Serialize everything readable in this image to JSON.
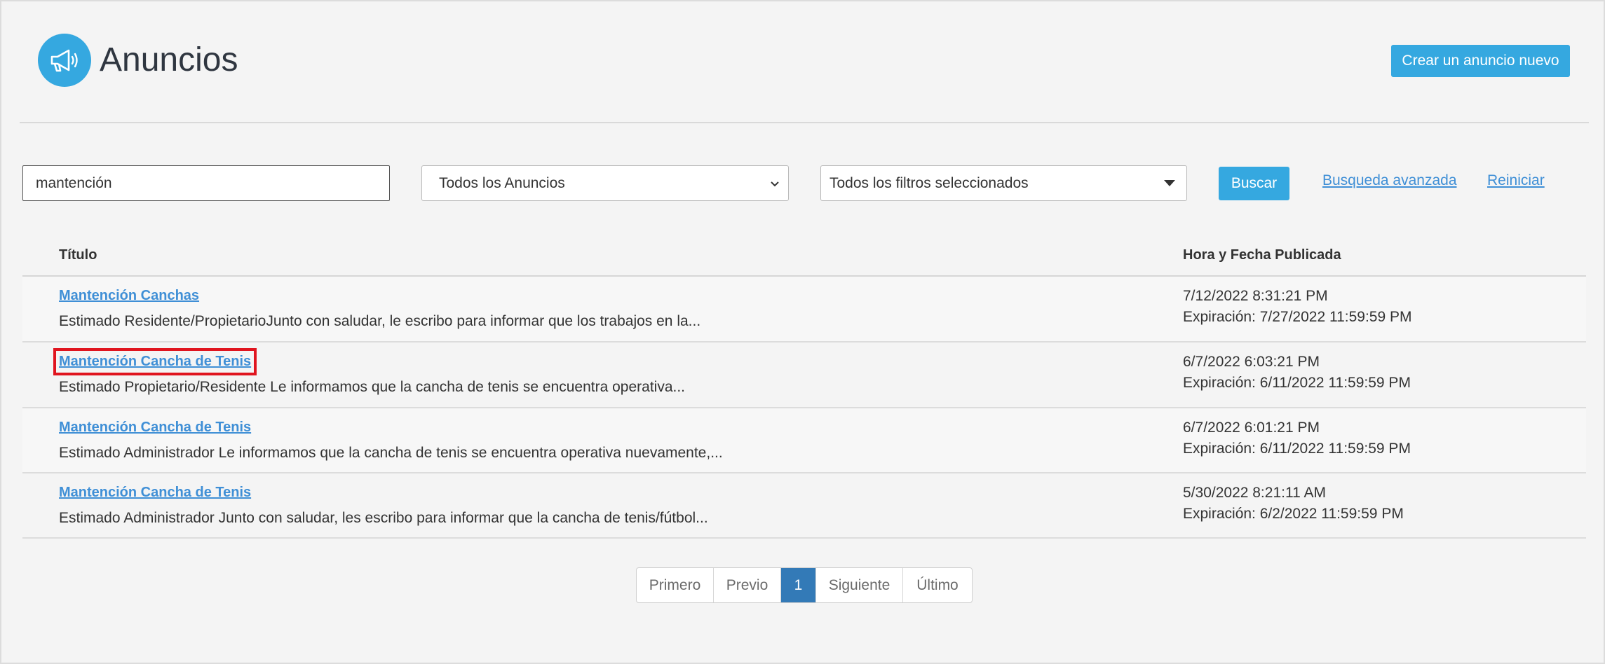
{
  "header": {
    "title": "Anuncios",
    "logo_icon": "megaphone-icon",
    "create_button": "Crear un anuncio nuevo"
  },
  "filters": {
    "search_value": "mantención",
    "type_select": "Todos los Anuncios",
    "filter_select": "Todos los filtros seleccionados",
    "search_button": "Buscar",
    "advanced_link": "Busqueda avanzada",
    "reset_link": "Reiniciar"
  },
  "table": {
    "columns": [
      "Título",
      "Hora y Fecha Publicada"
    ],
    "rows": [
      {
        "title": "Mantención Canchas",
        "excerpt": "Estimado Residente/PropietarioJunto con saludar, le escribo para informar que los trabajos en la...",
        "published": "7/12/2022 8:31:21 PM",
        "expiry": "Expiración: 7/27/2022 11:59:59 PM"
      },
      {
        "title": "Mantención Cancha de Tenis",
        "excerpt": "Estimado Propietario/Residente Le informamos que la cancha de tenis se encuentra operativa...",
        "published": "6/7/2022 6:03:21 PM",
        "expiry": "Expiración: 6/11/2022 11:59:59 PM"
      },
      {
        "title": "Mantención Cancha de Tenis",
        "excerpt": "Estimado Administrador Le informamos que la cancha de tenis se encuentra operativa nuevamente,...",
        "published": "6/7/2022 6:01:21 PM",
        "expiry": "Expiración: 6/11/2022 11:59:59 PM"
      },
      {
        "title": "Mantención Cancha de Tenis",
        "excerpt": "Estimado Administrador Junto con saludar, les escribo para informar que la cancha de tenis/fútbol...",
        "published": "5/30/2022 8:21:11 AM",
        "expiry": "Expiración: 6/2/2022 11:59:59 PM"
      }
    ]
  },
  "pagination": {
    "first": "Primero",
    "prev": "Previo",
    "current": "1",
    "next": "Siguiente",
    "last": "Último"
  },
  "colors": {
    "accent": "#35a8e0",
    "link": "#3f8fd6",
    "active_page": "#337ab7",
    "highlight": "#e0151f"
  }
}
